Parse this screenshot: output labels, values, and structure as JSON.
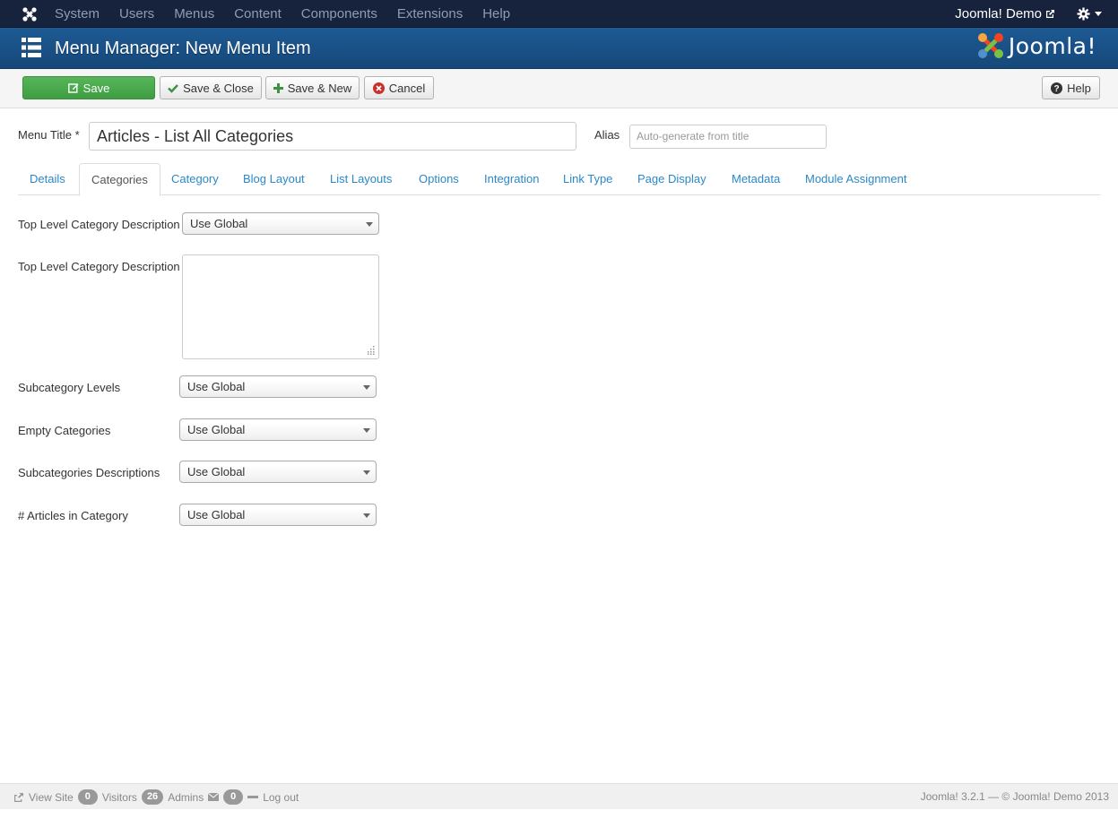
{
  "topnav": {
    "menu": [
      "System",
      "Users",
      "Menus",
      "Content",
      "Components",
      "Extensions",
      "Help"
    ],
    "site_link": "Joomla! Demo"
  },
  "header": {
    "title": "Menu Manager: New Menu Item",
    "brand": "Joomla!"
  },
  "toolbar": {
    "save": "Save",
    "save_close": "Save & Close",
    "save_new": "Save & New",
    "cancel": "Cancel",
    "help": "Help"
  },
  "form": {
    "title_label": "Menu Title *",
    "title_value": "Articles - List All Categories",
    "alias_label": "Alias",
    "alias_placeholder": "Auto-generate from title"
  },
  "tabs": [
    "Details",
    "Categories",
    "Category",
    "Blog Layout",
    "List Layouts",
    "Options",
    "Integration",
    "Link Type",
    "Page Display",
    "Metadata",
    "Module Assignment"
  ],
  "fields": {
    "top_desc_label": "Top Level Category Description",
    "top_desc_value": "Use Global",
    "top_desc_text_label": "Top Level Category Description",
    "subcat_levels_label": "Subcategory Levels",
    "subcat_levels_value": "Use Global",
    "empty_cats_label": "Empty Categories",
    "empty_cats_value": "Use Global",
    "subcat_desc_label": "Subcategories Descriptions",
    "subcat_desc_value": "Use Global",
    "articles_count_label": "# Articles in Category",
    "articles_count_value": "Use Global"
  },
  "footer": {
    "view_site": "View Site",
    "visitors_count": "0",
    "visitors": "Visitors",
    "admins_count": "26",
    "admins": "Admins",
    "messages_count": "0",
    "logout": "Log out",
    "copyright": "Joomla! 3.2.1 — © Joomla! Demo 2013"
  },
  "colors": {
    "navbar": "#17233d",
    "header": "#1d5a93",
    "save_button": "#4cae4f",
    "link": "#2a88c7"
  }
}
